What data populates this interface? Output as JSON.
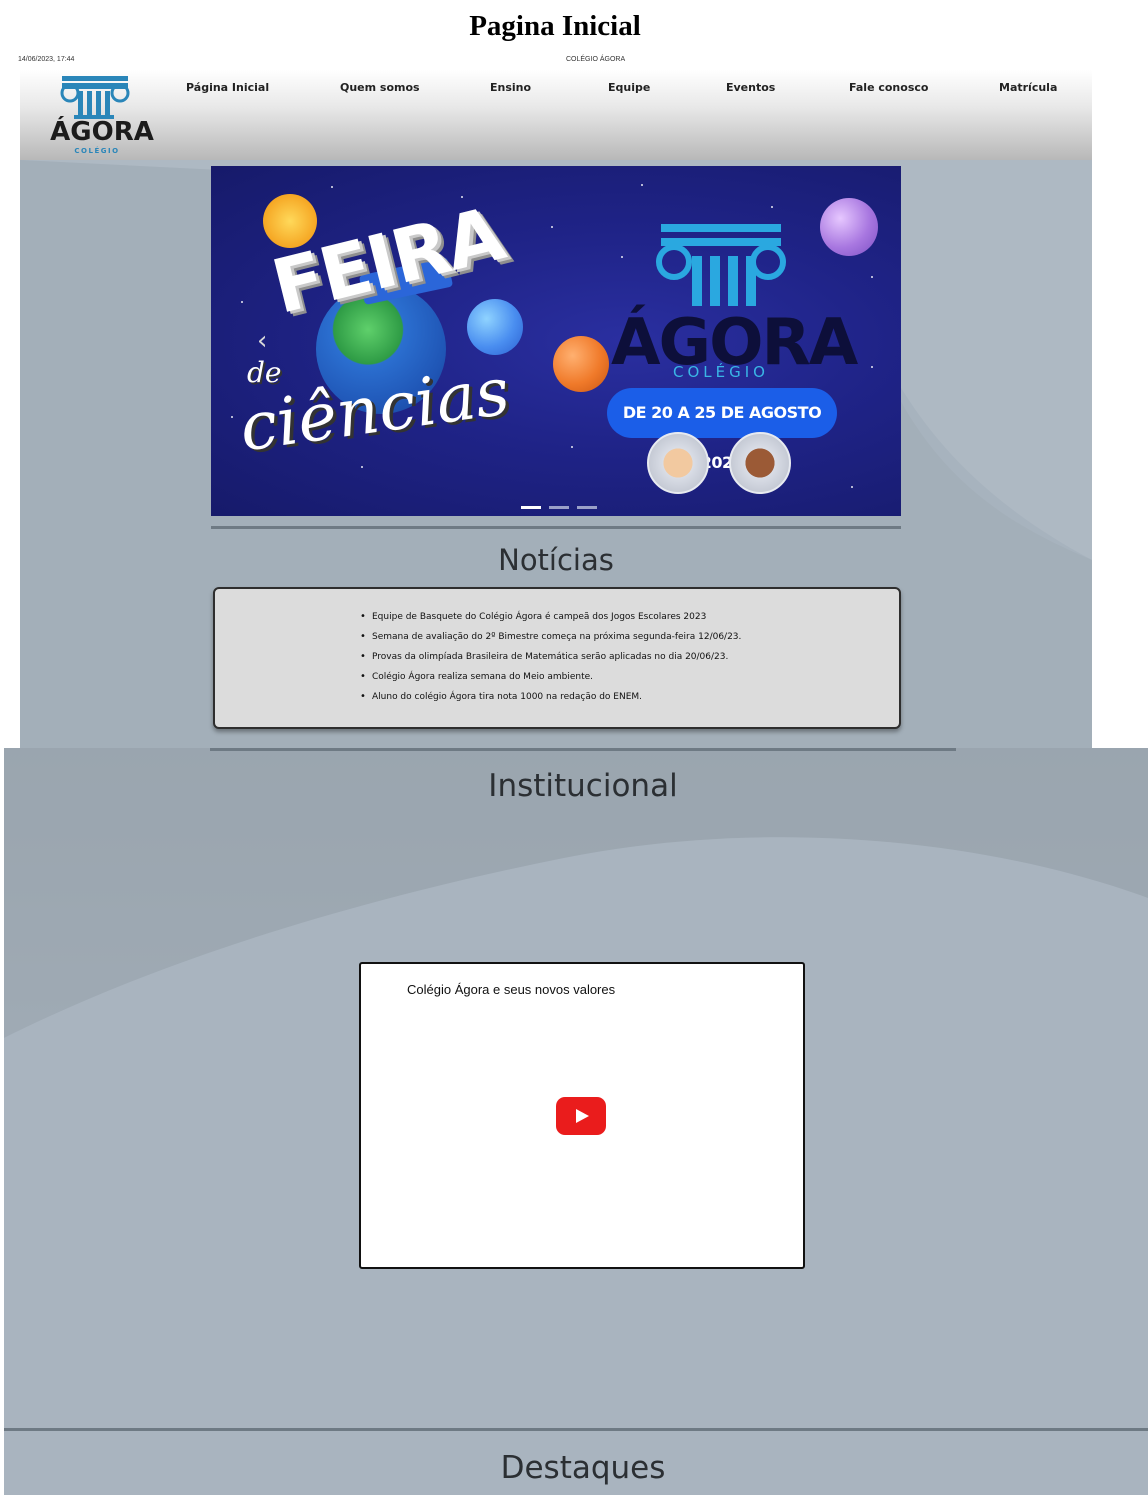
{
  "document": {
    "title": "Pagina Inicial",
    "print_date": "14/06/2023, 17:44",
    "site_name": "COLÉGIO ÁGORA"
  },
  "header": {
    "logo_word": "ÁGORA",
    "logo_sub": "COLÉGIO",
    "nav": [
      "Página Inicial",
      "Quem somos",
      "Ensino",
      "Equipe",
      "Eventos",
      "Fale conosco",
      "Matrícula"
    ]
  },
  "banner": {
    "feira": "FEIRA",
    "de": "de",
    "ciencias": "ciências",
    "logo_word": "ÁGORA",
    "logo_sub": "COLÉGIO",
    "dates": "DE 20 A 25 DE AGOSTO 2023",
    "prev_arrow": "‹",
    "slides_total": 3,
    "slide_active": 1
  },
  "noticias": {
    "title": "Notícias",
    "items": [
      "Equipe de Basquete do Colégio Ágora é campeã dos Jogos Escolares 2023",
      "Semana de avaliação do 2º Bimestre começa na próxima segunda-feira 12/06/23.",
      "Provas da olimpíada Brasileira de Matemática serão aplicadas no dia 20/06/23.",
      "Colégio Ágora realiza semana do Meio ambiente.",
      "Aluno do colégio Ágora tira nota 1000 na redação do ENEM."
    ]
  },
  "institucional": {
    "title": "Institucional",
    "video_title": "Colégio Ágora e seus novos valores",
    "play_icon": "youtube-play-icon"
  },
  "destaques": {
    "title": "Destaques"
  },
  "colors": {
    "accent_blue": "#1b5ee8",
    "logo_blue": "#2a86b9",
    "page_bg": "#a7b3be",
    "youtube_red": "#ea1c1c"
  }
}
